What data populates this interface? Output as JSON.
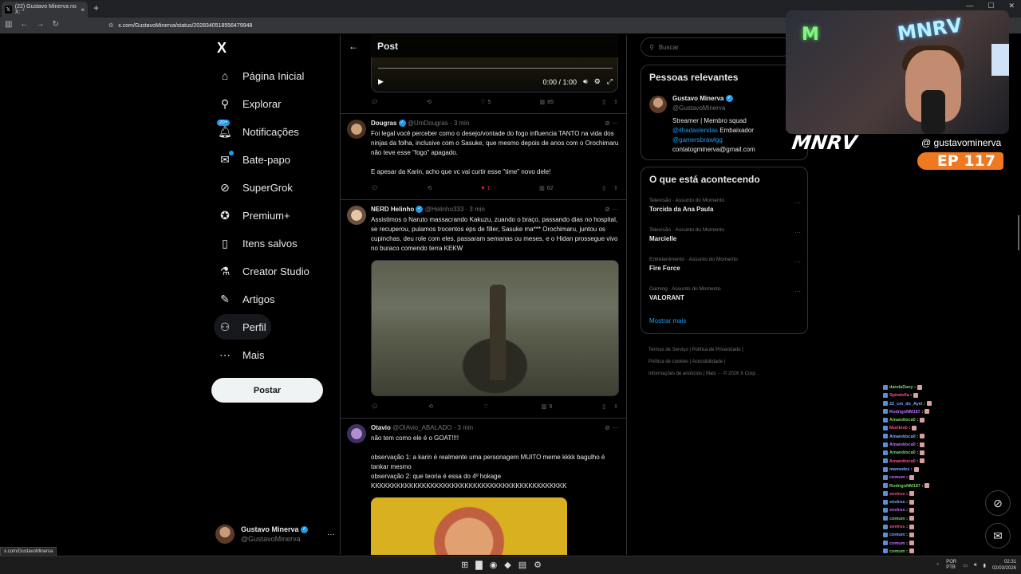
{
  "browser": {
    "tab_title": "(22) Gustavo Minerva no X: \"",
    "tab_close": "×",
    "new_tab": "+",
    "url": "x.com/GustavoMinerva/status/2028340518556479948",
    "status_bar_url": "x.com/GustavoMinerva"
  },
  "nav": {
    "logo": "X",
    "items": [
      {
        "label": "Página Inicial",
        "icon": "home-icon"
      },
      {
        "label": "Explorar",
        "icon": "search-icon"
      },
      {
        "label": "Notificações",
        "icon": "bell-icon",
        "badge": "20+"
      },
      {
        "label": "Bate-papo",
        "icon": "mail-icon"
      },
      {
        "label": "SuperGrok",
        "icon": "grok-icon"
      },
      {
        "label": "Premium+",
        "icon": "premium-icon"
      },
      {
        "label": "Itens salvos",
        "icon": "bookmark-icon"
      },
      {
        "label": "Creator Studio",
        "icon": "flask-icon"
      },
      {
        "label": "Artigos",
        "icon": "article-icon"
      },
      {
        "label": "Perfil",
        "icon": "person-icon"
      },
      {
        "label": "Mais",
        "icon": "more-circle-icon"
      }
    ],
    "post_button": "Postar",
    "account": {
      "name": "Gustavo Minerva",
      "handle": "@GustavoMinerva",
      "more": "···"
    }
  },
  "main": {
    "header_title": "Post",
    "back": "←",
    "video": {
      "time": "0:00 / 1:00"
    },
    "top_actions": {
      "replies": "",
      "reposts": "",
      "likes": "5",
      "views": "65"
    },
    "tweets": [
      {
        "name": "Dougras",
        "handle": "@UmDougras",
        "time": "3 min",
        "text1": "Foi legal você perceber como o desejo/vontade do fogo influencia TANTO na vida dos ninjas da folha, inclusive com o Sasuke, que mesmo depois de anos com o Orochimaru não teve esse \"fogo\" apagado.",
        "text2": "E apesar da Karin, acho que vc vai curtir esse \"time\" novo dele!",
        "likes": "1",
        "views": "62"
      },
      {
        "name": "NERD Helinho",
        "handle": "@Helinho333",
        "time": "3 min",
        "text1": "Assistimos o Naruto massacrando Kakuzu, zuando o braço, passando dias no hospital, se recuperou, pulamos trocentos eps de filler, Sasuke ma*** Orochimaru, juntou os cupinchas, deu role com eles, passaram semanas ou meses, e o Hidan prossegue vivo no buraco comendo terra KEKW",
        "likes": "",
        "views": "9"
      },
      {
        "name": "Otavio",
        "handle": "@OIAvio_ABALADO",
        "time": "3 min",
        "text1": "não tem como ele é o GOAT!!!!",
        "text2": "observação 1: a karin é realmente uma personagem MUITO meme kkkk bagulho é tankar mesmo",
        "text3": "observação 2: que teoria é essa do 4º hokage",
        "text4": "KKKKKKKKKKKKKKKKKKKKKKKKKKKKKKKKKKKKKKKKKKKKKK"
      }
    ]
  },
  "right": {
    "search_placeholder": "Buscar",
    "people_title": "Pessoas relevantes",
    "person": {
      "name": "Gustavo Minerva",
      "handle": "@GustavoMinerva",
      "bio1": "Streamer | Membro squad",
      "bio_link1": "@ilhadaslendas",
      "bio2": " Embaixador",
      "bio_link2": "@gamersbrawlgg",
      "bio3": "contatogminerva@gmail.com"
    },
    "trending_title": "O que está acontecendo",
    "trends": [
      {
        "category": "Televisão · Assunto do Momento",
        "title": "Torcida da Ana Paula"
      },
      {
        "category": "Televisão · Assunto do Momento",
        "title": "Marcielle"
      },
      {
        "category": "Entretenimento · Assunto do Momento",
        "title": "Fire Force"
      },
      {
        "category": "Gaming · Assunto do Momento",
        "title": "VALORANT"
      }
    ],
    "show_more": "Mostrar mais",
    "footer": [
      "Termos de Serviço",
      "Política de Privacidade",
      "Política de cookies",
      "Acessibilidade",
      "Informações de anúncios",
      "Mais ···",
      "© 2026 X Corp."
    ]
  },
  "overlay": {
    "cam_logo_left": "M",
    "cam_logo_right": "MNRV",
    "brand": "MNRV",
    "handle": "@ gustavominerva",
    "episode": "EP 117"
  },
  "chat": [
    {
      "user": "dandaDany",
      "msg": ""
    },
    {
      "user": "Spindolla",
      "msg": ""
    },
    {
      "user": "22_cm_do_Ayel",
      "msg": ""
    },
    {
      "user": "RodrigoNM187",
      "msg": ""
    },
    {
      "user": "Amandioca0",
      "msg": ""
    },
    {
      "user": "Murilovb",
      "msg": ""
    },
    {
      "user": "Amandioca0",
      "msg": ""
    },
    {
      "user": "Amandioca0",
      "msg": ""
    },
    {
      "user": "Amandioca0",
      "msg": ""
    },
    {
      "user": "Amandioca0",
      "msg": ""
    },
    {
      "user": "mamedes",
      "msg": ""
    },
    {
      "user": "comum",
      "msg": ""
    },
    {
      "user": "RodrigoNM187",
      "msg": ""
    },
    {
      "user": "sovirus",
      "msg": ""
    },
    {
      "user": "sovirus",
      "msg": ""
    },
    {
      "user": "sovirus",
      "msg": ""
    },
    {
      "user": "comum",
      "msg": ""
    },
    {
      "user": "sovirus",
      "msg": ""
    },
    {
      "user": "comum",
      "msg": ""
    },
    {
      "user": "comum",
      "msg": ""
    },
    {
      "user": "comum",
      "msg": ""
    },
    {
      "user": "RodrigoNM187",
      "msg": ""
    }
  ],
  "taskbar": {
    "lang1": "POR",
    "lang2": "PTB",
    "time": "02:31",
    "date": "02/03/2026"
  },
  "colors": {
    "accent": "#1d9bf0",
    "like": "#f91880",
    "episode": "#f07820"
  }
}
